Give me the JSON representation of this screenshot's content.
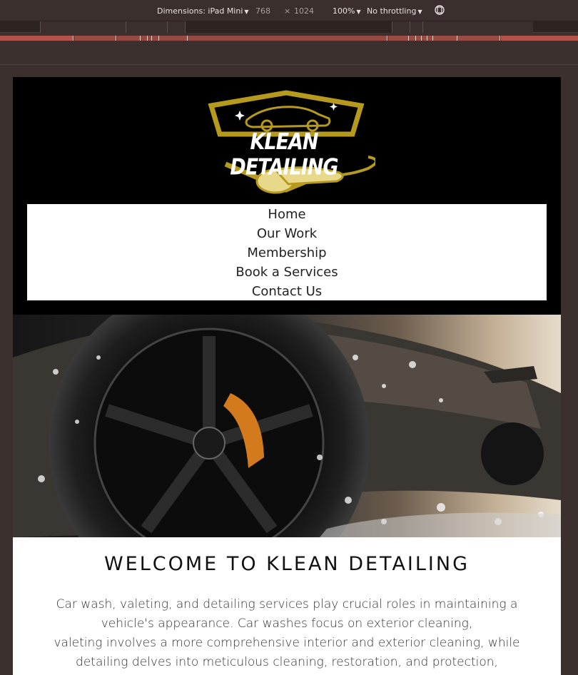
{
  "devtools": {
    "dimensions_label": "Dimensions: iPad Mini",
    "width": "768",
    "times": "×",
    "height": "1024",
    "zoom": "100%",
    "throttling": "No throttling",
    "rotate_icon": "rotate-icon"
  },
  "site": {
    "logo_text": "KLEAN DETAILING",
    "nav": [
      "Home",
      "Our Work",
      "Membership",
      "Book a Services",
      "Contact Us"
    ],
    "welcome_title": "WELCOME TO KLEAN DETAILING",
    "intro_lines": [
      "Car wash, valeting, and detailing services play crucial roles in maintaining a",
      "vehicle's appearance. Car washes focus on exterior cleaning,",
      "valeting involves a more comprehensive interior and exterior cleaning, while",
      "detailing delves into meticulous cleaning, restoration, and protection,"
    ],
    "accent_color": "#b59a1e"
  }
}
